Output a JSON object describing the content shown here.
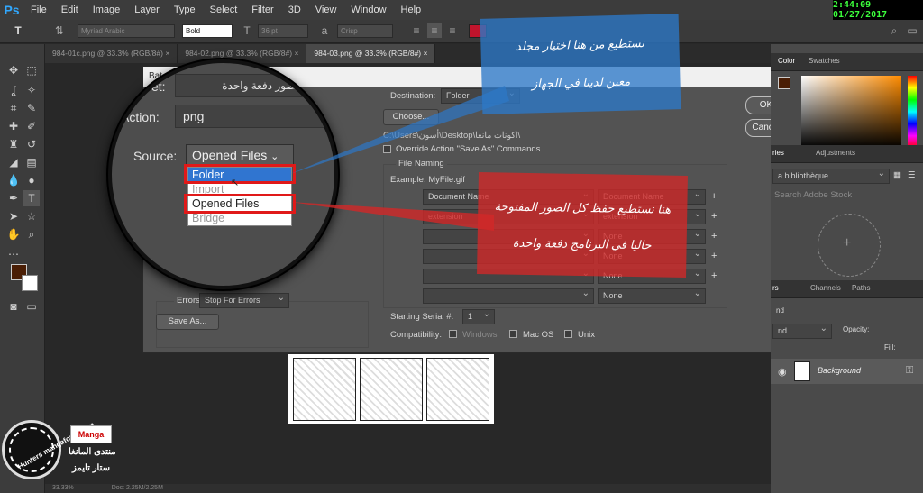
{
  "app": {
    "logo": "Ps"
  },
  "menu": [
    "File",
    "Edit",
    "Image",
    "Layer",
    "Type",
    "Select",
    "Filter",
    "3D",
    "View",
    "Window",
    "Help"
  ],
  "clock": "2:44:09 01/27/2017",
  "options_bar": {
    "tool_icon": "T",
    "font_family": "Myriad Arabic",
    "font_style": "Bold",
    "font_size": "36 pt",
    "anti_alias": "Crisp",
    "text_color": "#c0142c"
  },
  "doc_tabs": [
    {
      "label": "984-01c.png @ 33.3% (RGB/8#)",
      "close": "×"
    },
    {
      "label": "984-02.png @ 33.3% (RGB/8#)",
      "close": "×"
    },
    {
      "label": "984-03.png @ 33.3% (RGB/8#)",
      "close": "×"
    }
  ],
  "colors": {
    "foreground": "#4a1e05",
    "background": "#ffffff",
    "accent_red": "#e01919",
    "callout_blue": "#2d78c8",
    "callout_red": "#d22828"
  },
  "dialog": {
    "title": "Bat",
    "close": "✕",
    "ok": "OK",
    "cancel": "Cancel",
    "destination_label": "Destination:",
    "destination_value": "Folder",
    "choose_button": "Choose...",
    "path": "C:\\Users\\أسون\\Desktop\\اكونات مانغا\\",
    "override_label": "Override Action \"Save As\" Commands",
    "file_naming_label": "File Naming",
    "example_label": "Example: MyFile.gif",
    "naming_rows": [
      {
        "left": "Document Name",
        "right": "Document Name"
      },
      {
        "left": "extension",
        "right": "extension"
      },
      {
        "left": "",
        "right": "None"
      },
      {
        "left": "",
        "right": "None"
      },
      {
        "left": "",
        "right": "None"
      },
      {
        "left": "",
        "right": "None"
      }
    ],
    "starting_serial_label": "Starting Serial #:",
    "starting_serial_value": "1",
    "compat_label": "Compatibility:",
    "compat_windows": "Windows",
    "compat_mac": "Mac OS",
    "compat_unix": "Unix",
    "errors_label": "Errors:",
    "errors_value": "Stop For Errors",
    "save_as_button": "Save As..."
  },
  "magnifier": {
    "set_value": "حفظ الصور دفعة واحدة",
    "set_label": "et:",
    "action_label": "Action:",
    "action_value": "png",
    "source_label": "Source:",
    "source_value": "Opened Files",
    "source_options": [
      "Folder",
      "Import",
      "Opened Files",
      "Bridge"
    ],
    "source_selected": "Folder"
  },
  "callouts": {
    "blue_line1": "نستطيع من هنا اختيار مجلد",
    "blue_line2": "معين لدينا في الجهاز",
    "red_line1": "هنا نستطيع حفظ كل الصور المفتوحة",
    "red_line2": "حاليا في البرنامج دفعة واحدة"
  },
  "right_panel": {
    "color_tab": "Color",
    "swatches_tab": "Swatches",
    "libraries_tab": "ries",
    "adjustments_tab": "Adjustments",
    "library_select": "a bibliothèque",
    "search_placeholder": "Search Adobe Stock",
    "layers_tab": "rs",
    "channels_tab": "Channels",
    "paths_tab": "Paths",
    "blend_mode": "nd",
    "opacity_label": "Opacity:",
    "fill_label": "Fill:",
    "layer_name": "Background"
  },
  "watermark": {
    "ring_text": "Hunters mangaforall.com",
    "logo_text": "Manga",
    "line1": "منتدى المانغا",
    "line2": "ستار تايمز"
  },
  "status": {
    "zoom": "33.33%",
    "doc": "Doc: 2.25M/2.25M"
  }
}
